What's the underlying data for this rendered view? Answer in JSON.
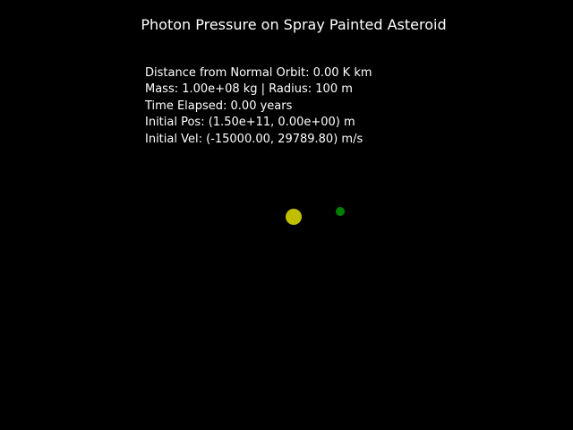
{
  "title": "Photon Pressure on Spray Painted Asteroid",
  "info": {
    "distance": "Distance from Normal Orbit: 0.00 K km",
    "mass_radius": "Mass: 1.00e+08 kg | Radius: 100 m",
    "time_elapsed": "Time Elapsed: 0.00 years",
    "initial_pos": "Initial Pos: (1.50e+11, 0.00e+00) m",
    "initial_vel": "Initial Vel: (-15000.00, 29789.80) m/s"
  },
  "colors": {
    "background": "#000000",
    "text": "#ffffff",
    "sun": "#bfbf00",
    "asteroid": "#008000"
  }
}
